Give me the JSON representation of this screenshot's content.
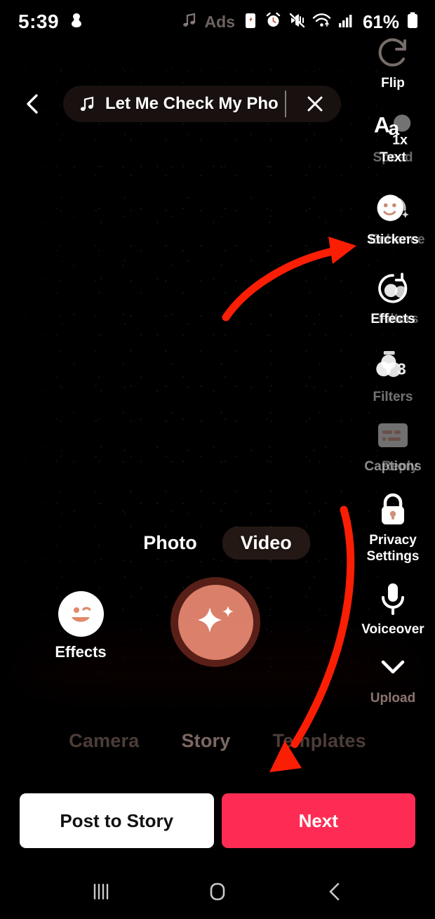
{
  "status_bar": {
    "time": "5:39",
    "notification_icon": "app-notification-icon",
    "music_icon": "music-note-icon",
    "ads_text": "Ads",
    "icons": [
      "battery-saver-icon",
      "alarm-clock-icon",
      "vibrate-mute-icon",
      "wifi-icon",
      "cellular-signal-icon"
    ],
    "battery_percent": "61%",
    "battery_icon": "battery-icon"
  },
  "topbar": {
    "back_icon": "back-chevron-icon",
    "music_note_icon": "music-note-icon",
    "music_title": "Let Me Check My Phone",
    "close_icon": "close-x-icon"
  },
  "sidebar": {
    "items": [
      {
        "icon": "flip-camera-icon",
        "label": "Flip",
        "ghost_label": ""
      },
      {
        "icon": "text-aa-icon",
        "label": "Text",
        "ghost_label": "Speed",
        "badge": "1x"
      },
      {
        "icon": "stickers-smiley-icon",
        "label": "Stickers",
        "ghost_label": "Enhance"
      },
      {
        "icon": "effects-timer-icon",
        "label": "Effects",
        "ghost_label": "Filters"
      },
      {
        "icon": "filters-circles-icon",
        "label": "Filters",
        "ghost_label": "",
        "badge": "3"
      },
      {
        "icon": "captions-card-icon",
        "label": "Captions",
        "ghost_label": "Reply"
      },
      {
        "icon": "privacy-lock-icon",
        "label": "Privacy",
        "label2": "Settings",
        "ghost_label": ""
      },
      {
        "icon": "voiceover-mic-icon",
        "label": "Voiceover",
        "ghost_label": ""
      },
      {
        "icon": "upload-chevron-icon",
        "label": "Upload",
        "ghost_label": ""
      }
    ]
  },
  "modes": {
    "photo": "Photo",
    "video": "Video",
    "selected": "Video"
  },
  "capture": {
    "effects_icon": "winking-smiley-icon",
    "effects_label": "Effects",
    "record_icon": "sparkle-star-icon"
  },
  "bottom_tabs": {
    "items": [
      "Camera",
      "Story",
      "Templates"
    ],
    "selected": "Story"
  },
  "actions": {
    "post_to_story": "Post to Story",
    "next": "Next"
  },
  "nav_bar": {
    "recents_icon": "recents-icon",
    "home_icon": "home-icon",
    "back_icon": "nav-back-icon"
  },
  "annotations": {
    "arrow_to_effects": "curved-arrow-up-right",
    "arrow_to_next": "curved-arrow-down"
  },
  "colors": {
    "accent_red": "#FE2C55",
    "annotation_red": "#FA1E05",
    "button_white": "#FFFFFF"
  }
}
